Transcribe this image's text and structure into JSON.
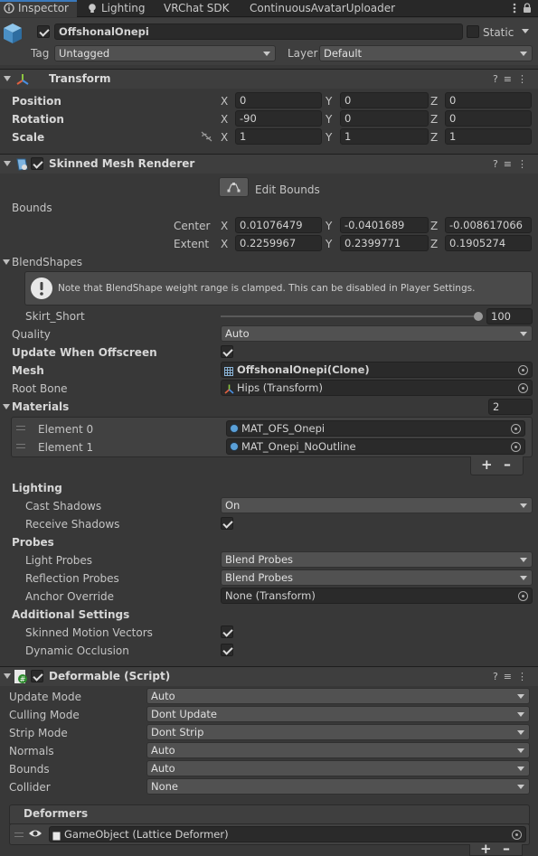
{
  "tabs": [
    {
      "label": "Inspector",
      "icon": "info-icon",
      "active": true
    },
    {
      "label": "Lighting",
      "icon": "bulb-icon",
      "active": false
    },
    {
      "label": "VRChat SDK",
      "active": false
    },
    {
      "label": "ContinuousAvatarUploader",
      "active": false
    }
  ],
  "object": {
    "name": "OffshonalOnepi",
    "active": true,
    "static_label": "Static",
    "tag_label": "Tag",
    "tag_value": "Untagged",
    "layer_label": "Layer",
    "layer_value": "Default"
  },
  "transform": {
    "title": "Transform",
    "axes": [
      "X",
      "Y",
      "Z"
    ],
    "position_label": "Position",
    "position": [
      "0",
      "0",
      "0"
    ],
    "rotation_label": "Rotation",
    "rotation": [
      "-90",
      "0",
      "0"
    ],
    "scale_label": "Scale",
    "scale": [
      "1",
      "1",
      "1"
    ]
  },
  "skinned_mesh": {
    "title": "Skinned Mesh Renderer",
    "edit_bounds": "Edit Bounds",
    "bounds_label": "Bounds",
    "center_label": "Center",
    "center": [
      "0.01076479",
      "-0.0401689",
      "-0.008617066"
    ],
    "extent_label": "Extent",
    "extent": [
      "0.2259967",
      "0.2399771",
      "0.1905274"
    ],
    "blendshapes_label": "BlendShapes",
    "blendshapes_note": "Note that BlendShape weight range is clamped. This can be disabled in Player Settings.",
    "skirt_label": "Skirt_Short",
    "skirt_value": "100",
    "skirt_fraction": 1.0,
    "quality_label": "Quality",
    "quality_value": "Auto",
    "update_offscreen_label": "Update When Offscreen",
    "mesh_label": "Mesh",
    "mesh_value": "OffshonalOnepi(Clone)",
    "root_bone_label": "Root Bone",
    "root_bone_value": "Hips (Transform)",
    "materials_label": "Materials",
    "materials_count": "2",
    "materials": [
      {
        "label": "Element 0",
        "value": "MAT_OFS_Onepi"
      },
      {
        "label": "Element 1",
        "value": "MAT_Onepi_NoOutline"
      }
    ],
    "lighting_label": "Lighting",
    "cast_shadows_label": "Cast Shadows",
    "cast_shadows_value": "On",
    "receive_shadows_label": "Receive Shadows",
    "probes_label": "Probes",
    "light_probes_label": "Light Probes",
    "light_probes_value": "Blend Probes",
    "reflection_probes_label": "Reflection Probes",
    "reflection_probes_value": "Blend Probes",
    "anchor_override_label": "Anchor Override",
    "anchor_override_value": "None (Transform)",
    "additional_label": "Additional Settings",
    "skinned_motion_label": "Skinned Motion Vectors",
    "dynamic_occlusion_label": "Dynamic Occlusion"
  },
  "deformable": {
    "title": "Deformable (Script)",
    "rows": [
      {
        "label": "Update Mode",
        "value": "Auto"
      },
      {
        "label": "Culling Mode",
        "value": "Dont Update"
      },
      {
        "label": "Strip Mode",
        "value": "Dont Strip"
      },
      {
        "label": "Normals",
        "value": "Auto"
      },
      {
        "label": "Bounds",
        "value": "Auto"
      },
      {
        "label": "Collider",
        "value": "None"
      }
    ],
    "deformers_label": "Deformers",
    "deformer_value": "GameObject (Lattice Deformer)"
  },
  "colors": {
    "accent": "#3a79bb",
    "background": "#383838"
  }
}
